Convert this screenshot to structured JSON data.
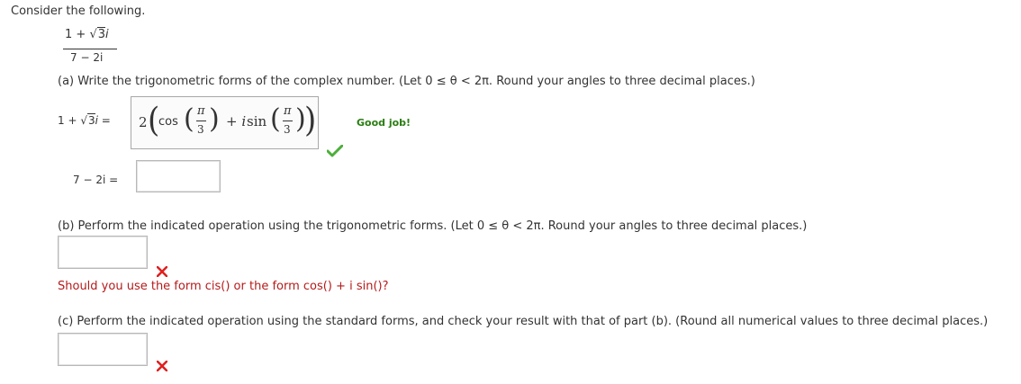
{
  "intro": "Consider the following.",
  "expression": {
    "numerator_prefix": "1 + ",
    "numerator_radicand": "3",
    "numerator_suffix": "i",
    "denominator": "7 − 2i"
  },
  "part_a": {
    "prompt": "(a) Write the trigonometric forms of the complex number. (Let 0 ≤ θ < 2π. Round your angles to three decimal places.)",
    "label1_prefix": "1 + ",
    "label1_radicand": "3",
    "label1_suffix": "i  =",
    "answer1": {
      "coef": "2",
      "cos": "cos",
      "num": "π",
      "den": "3",
      "plus_i": "+ i",
      "sin": "sin",
      "num2": "π",
      "den2": "3"
    },
    "answer1_feedback": "Good job!",
    "label2": "7 − 2i  =",
    "answer2_value": ""
  },
  "part_b": {
    "prompt": "(b) Perform the indicated operation using the trigonometric forms. (Let 0 ≤ θ < 2π. Round your angles to three decimal places.)",
    "answer_value": "",
    "hint": "Should you use the form cis() or the form cos() + i sin()?"
  },
  "part_c": {
    "prompt": "(c) Perform the indicated operation using the standard forms, and check your result with that of part (b). (Round all numerical values to three decimal places.)",
    "answer_value": ""
  },
  "colors": {
    "correct": "#2a7d12",
    "incorrect": "#cc1111",
    "hint": "#b51a1a"
  }
}
